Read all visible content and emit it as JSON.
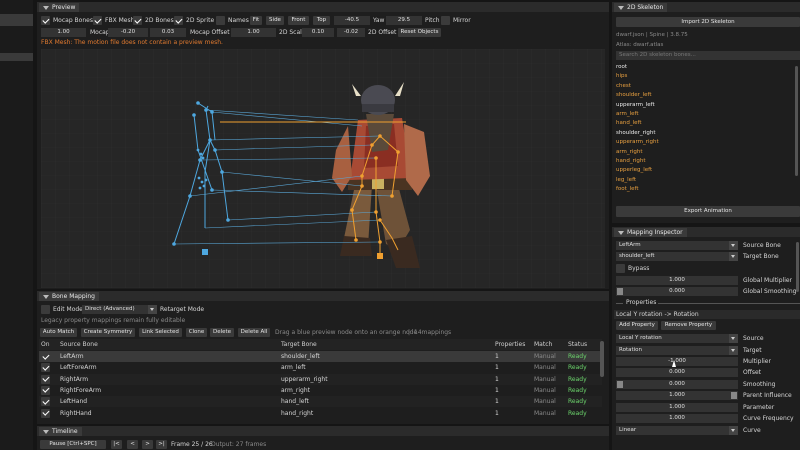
{
  "preview": {
    "tab": "Preview",
    "toolbar1": {
      "mocap_bones": "Mocap Bones",
      "fbx_mesh": "FBX Mesh",
      "bones_2d": "2D Bones",
      "sprite_2d": "2D Sprite",
      "names": "Names",
      "fit": "Fit",
      "side": "Side",
      "front": "Front",
      "top": "Top",
      "yaw_value": "-40.5",
      "yaw_label": "Yaw",
      "pitch_value": "29.5",
      "pitch_label": "Pitch",
      "mirror": "Mirror"
    },
    "toolbar2": {
      "mocap_scale_value": "1.00",
      "mocap_scale_label": "Mocap Scale",
      "offset_x": "-0.20",
      "offset_y": "0.03",
      "mocap_offset_label": "Mocap Offset",
      "scale_2d_value": "1.00",
      "scale_2d_label": "2D Scale",
      "offset2d_x": "0.10",
      "offset2d_y": "-0.02",
      "offset_2d_label": "2D Offset",
      "reset_objects": "Reset Objects"
    },
    "warning": "FBX Mesh: The motion file does not contain a preview mesh.",
    "colors": {
      "mocap": "#4ea8e0",
      "skeleton2d": "#f0a030",
      "viewport": "#262626"
    }
  },
  "bone_mapping": {
    "tab": "Bone Mapping",
    "edit_mode": "Edit Mode",
    "mode_value": "Direct (Advanced)",
    "retarget_mode": "Retarget Mode",
    "legacy_note": "Legacy property mappings remain fully editable",
    "buttons": {
      "auto_match": "Auto Match",
      "create_symmetry": "Create Symmetry",
      "link_selected": "Link Selected",
      "clone": "Clone",
      "delete": "Delete",
      "delete_all": "Delete All"
    },
    "hint": "Drag a blue preview node onto an orange node",
    "separator": "|",
    "count": "14mappings",
    "columns": {
      "on": "On",
      "source": "Source Bone",
      "target": "Target Bone",
      "properties": "Properties",
      "match": "Match",
      "status": "Status"
    },
    "rows": [
      {
        "source": "LeftArm",
        "target": "shoulder_left",
        "properties": "1",
        "match": "Manual",
        "status": "Ready"
      },
      {
        "source": "LeftForeArm",
        "target": "arm_left",
        "properties": "1",
        "match": "Manual",
        "status": "Ready"
      },
      {
        "source": "RightArm",
        "target": "upperarm_right",
        "properties": "1",
        "match": "Manual",
        "status": "Ready"
      },
      {
        "source": "RightForeArm",
        "target": "arm_right",
        "properties": "1",
        "match": "Manual",
        "status": "Ready"
      },
      {
        "source": "LeftHand",
        "target": "hand_left",
        "properties": "1",
        "match": "Manual",
        "status": "Ready"
      },
      {
        "source": "RightHand",
        "target": "hand_right",
        "properties": "1",
        "match": "Manual",
        "status": "Ready"
      }
    ]
  },
  "timeline": {
    "tab": "Timeline",
    "pause": "Pause [Ctrl+SPC]",
    "first": "|<",
    "prev": "<",
    "next": ">",
    "last": ">|",
    "frame": "Frame 25 / 26",
    "output": "Output: 27 frames"
  },
  "skeleton_2d": {
    "tab": "2D Skeleton",
    "import": "Import 2D Skeleton",
    "file_info": "dwarf.json  |  Spine  |  3.8.75",
    "atlas": "Atlas: dwarf.atlas",
    "search_placeholder": "Search 2D skeleton bones...",
    "bones": [
      {
        "name": "root",
        "mapped": false
      },
      {
        "name": "hips",
        "mapped": true
      },
      {
        "name": "chest",
        "mapped": true
      },
      {
        "name": "shoulder_left",
        "mapped": true
      },
      {
        "name": "upperarm_left",
        "mapped": false
      },
      {
        "name": "arm_left",
        "mapped": true
      },
      {
        "name": "hand_left",
        "mapped": true
      },
      {
        "name": "shoulder_right",
        "mapped": false
      },
      {
        "name": "upperarm_right",
        "mapped": true
      },
      {
        "name": "arm_right",
        "mapped": true
      },
      {
        "name": "hand_right",
        "mapped": true
      },
      {
        "name": "upperleg_left",
        "mapped": true
      },
      {
        "name": "leg_left",
        "mapped": true
      },
      {
        "name": "foot_left",
        "mapped": true
      }
    ],
    "export": "Export Animation"
  },
  "mapping_inspector": {
    "tab": "Mapping Inspector",
    "source_bone_value": "LeftArm",
    "source_bone_label": "Source Bone",
    "target_bone_value": "shoulder_left",
    "target_bone_label": "Target Bone",
    "bypass": "Bypass",
    "global_multiplier_value": "1.000",
    "global_multiplier_label": "Global Multiplier",
    "global_smoothing_value": "0.000",
    "global_smoothing_label": "Global Smoothing",
    "properties_header": "Properties",
    "property_item": "Local Y rotation -> Rotation",
    "add_property": "Add Property",
    "remove_property": "Remove Property",
    "source_value": "Local Y rotation",
    "source_label": "Source",
    "target_value": "Rotation",
    "target_label": "Target",
    "multiplier_value": "-1.000",
    "multiplier_label": "Multiplier",
    "offset_value": "0.000",
    "offset_label": "Offset",
    "smoothing_value": "0.000",
    "smoothing_label": "Smoothing",
    "parent_influence_value": "1.000",
    "parent_influence_label": "Parent Influence",
    "parameter_value": "1.000",
    "parameter_label": "Parameter",
    "curve_frequency_value": "1.000",
    "curve_frequency_label": "Curve Frequency",
    "curve_value": "Linear",
    "curve_label": "Curve"
  }
}
